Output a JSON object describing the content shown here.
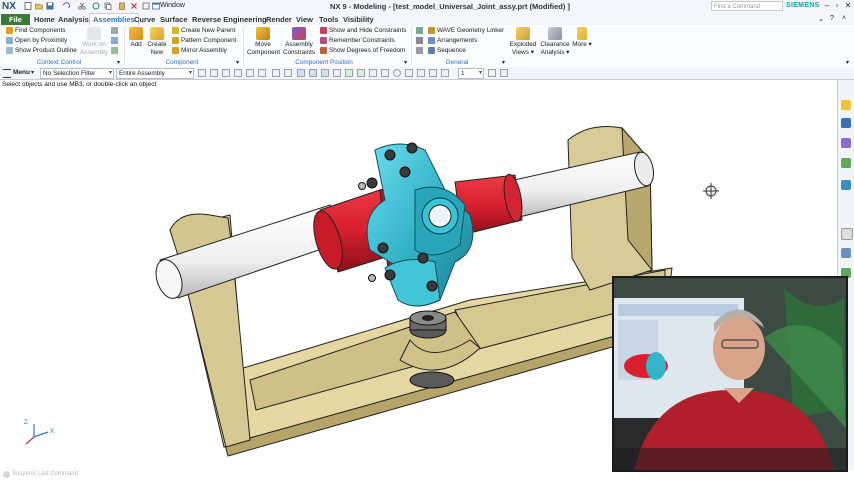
{
  "app": {
    "logo": "NX",
    "window_menu": "Window",
    "title": "NX 9 - Modeling - [test_model_Universal_Joint_assy.prt (Modified) ]",
    "find_command_placeholder": "Find a Command",
    "brand": "SIEMENS"
  },
  "tabs": [
    "File",
    "Home",
    "Analysis",
    "Assemblies",
    "Curve",
    "Surface",
    "Reverse Engineering",
    "Render",
    "View",
    "Tools",
    "Visibility"
  ],
  "active_tab": "Assemblies",
  "ribbon": {
    "context_control": {
      "items": [
        "Find Components",
        "Open by Proximity",
        "Show Product Outline"
      ],
      "work_on_assembly": "Work on Assembly",
      "label": "Context Control"
    },
    "component": {
      "add": "Add",
      "create_new": "Create New",
      "items": [
        "Create New Parent",
        "Pattern Component",
        "Mirror Assembly"
      ],
      "label": "Component"
    },
    "component_position": {
      "move_component": "Move Component",
      "assembly_constraints": "Assembly Constraints",
      "items": [
        "Show and Hide Constraints",
        "Remember Constraints",
        "Show Degrees of Freedom"
      ],
      "label": "Component Position"
    },
    "general": {
      "items": [
        "WAVE Geometry Linker",
        "Arrangements",
        "Sequence"
      ],
      "exploded_views": "Exploded Views",
      "clearance_analysis": "Clearance Analysis",
      "more": "More",
      "label": "General"
    }
  },
  "selection_bar": {
    "menu": "Menu",
    "filter": "No Selection Filter",
    "scope": "Entire Assembly",
    "value": "1"
  },
  "cue_line": "Select objects and use MB3, or double-click an object",
  "status_bar": "Suspend Last Command",
  "colors": {
    "base": "#d9cb97",
    "shaft": "#f4f4f4",
    "yoke": "#d8202f",
    "spider": "#3bb7c9",
    "accent": "#2a72c2",
    "file_tab": "#3d7a3a"
  }
}
